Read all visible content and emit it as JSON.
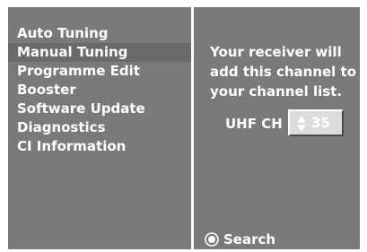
{
  "menu": {
    "items": [
      {
        "label": "Auto Tuning"
      },
      {
        "label": "Manual Tuning"
      },
      {
        "label": "Programme Edit"
      },
      {
        "label": "Booster"
      },
      {
        "label": "Software Update"
      },
      {
        "label": "Diagnostics"
      },
      {
        "label": "CI Information"
      }
    ],
    "selected_index": 1
  },
  "panel": {
    "message_lines": [
      "Your receiver will",
      "add this channel to",
      "your channel list."
    ],
    "channel_label": "UHF CH",
    "channel_value": "35",
    "stepper_icon": "up-down-arrows-icon",
    "search_label": "Search",
    "search_icon": "ok-button-icon"
  },
  "colors": {
    "osd_background": "#7a7a7a",
    "selected_row": "#6a6a6a",
    "text": "#ffffff",
    "stepper_background": "#dcdcdc"
  }
}
